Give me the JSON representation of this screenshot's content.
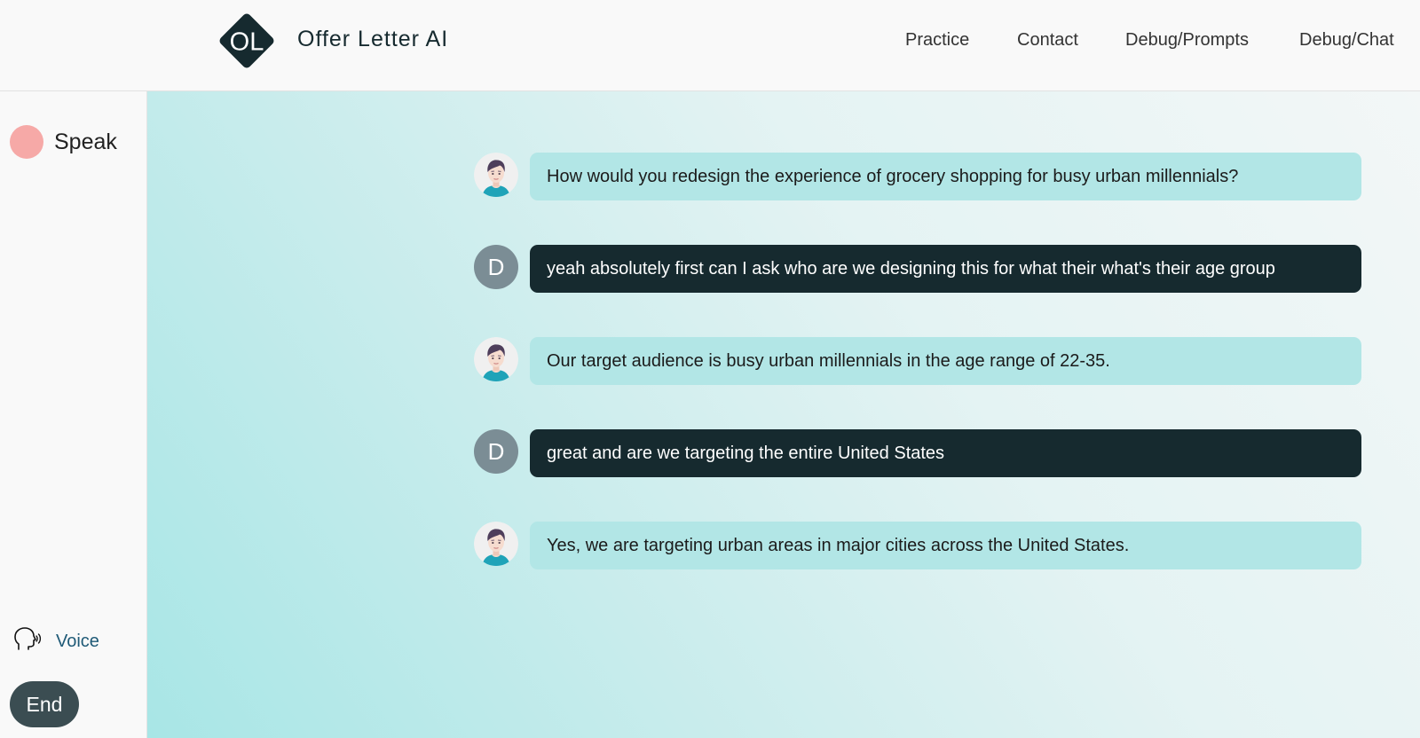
{
  "header": {
    "logo_text": "OL",
    "brand": "Offer Letter AI",
    "nav": [
      "Practice",
      "Contact",
      "Debug/Prompts",
      "Debug/Chat"
    ]
  },
  "sidebar": {
    "speak_label": "Speak",
    "voice_label": "Voice",
    "end_label": "End"
  },
  "colors": {
    "brand_dark": "#162a2f",
    "ai_bubble": "#b2e6e6",
    "speak_dot": "#f6a9a7",
    "user_avatar": "#7b8d95",
    "end_button": "#3b4d52"
  },
  "messages": [
    {
      "role": "ai",
      "avatar": "interviewer-avatar-icon",
      "text": "How would you redesign the experience of grocery shopping for busy urban millennials?"
    },
    {
      "role": "user",
      "avatar_letter": "D",
      "text": "yeah absolutely first can I ask who are we designing this for what their what's their age group"
    },
    {
      "role": "ai",
      "avatar": "interviewer-avatar-icon",
      "text": "Our target audience is busy urban millennials in the age range of 22-35."
    },
    {
      "role": "user",
      "avatar_letter": "D",
      "text": "great and are we targeting the entire United States"
    },
    {
      "role": "ai",
      "avatar": "interviewer-avatar-icon",
      "text": "Yes, we are targeting urban areas in major cities across the United States."
    }
  ]
}
